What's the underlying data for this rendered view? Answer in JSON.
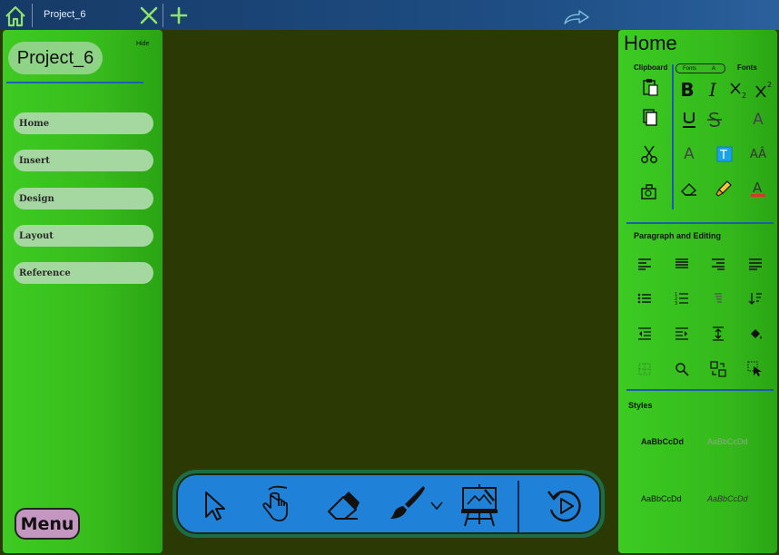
{
  "topbar": {
    "tab_title": "Project_6",
    "icons": [
      "home-icon",
      "close-icon",
      "plus-icon",
      "redo-icon"
    ]
  },
  "left_panel": {
    "project_title": "Project_6",
    "hide_label": "Hide",
    "nav_items": [
      {
        "label": "Home"
      },
      {
        "label": "Insert"
      },
      {
        "label": "Design"
      },
      {
        "label": "Layout"
      },
      {
        "label": "Reference"
      }
    ],
    "menu_label": "Menu"
  },
  "toolbar": {
    "tools": [
      "select-pointer-icon",
      "touch-hand-icon",
      "eraser-icon",
      "brush-icon",
      "chevron-down-icon",
      "easel-icon",
      "replay-icon"
    ]
  },
  "right_panel": {
    "title": "Home",
    "clipboard_label": "Clipboard",
    "fonts_label": "Fonts",
    "fonts_dropdown": "Fonts",
    "fonts_dropdown_letter": "A",
    "paragraph_label": "Paragraph and Editing",
    "styles_label": "Styles",
    "style_samples": [
      "AaBbCcDd",
      "AaBbCcDd",
      "AaBbCcDd",
      "AaBbCcDd"
    ]
  },
  "colors": {
    "canvas": "#2b3a05",
    "panel_green": "#3ecb22",
    "topbar_blue": "#1f4f86",
    "toolbar_blue": "#1f82d8",
    "accent_line": "#1d5bb0",
    "menu_pink": "#c497c1",
    "highlight_cyan": "#1aa3e8"
  }
}
